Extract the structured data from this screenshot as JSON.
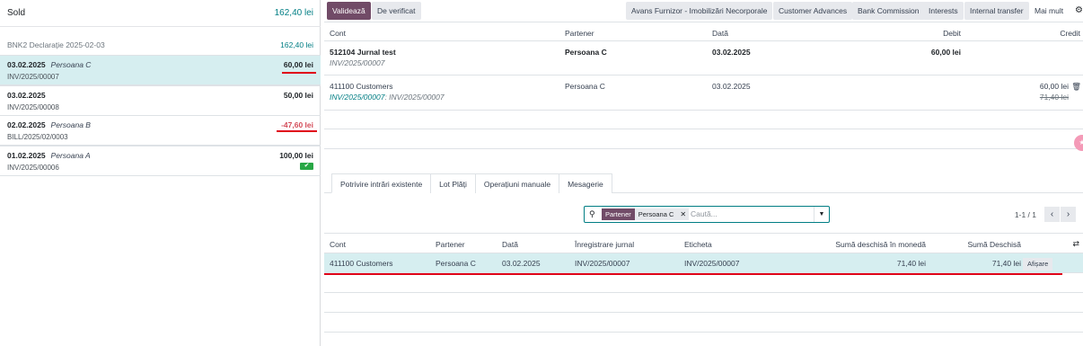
{
  "left": {
    "sold_label": "Sold",
    "sold_value": "162,40 lei",
    "statement_label": "BNK2 Declarație 2025-02-03",
    "statement_value": "162,40 lei",
    "lines": [
      {
        "date": "03.02.2025",
        "partner": "Persoana C",
        "ref": "INV/2025/00007",
        "amount": "60,00 lei",
        "selected": true
      },
      {
        "date": "03.02.2025",
        "partner": "",
        "ref": "INV/2025/00008",
        "amount": "50,00 lei"
      },
      {
        "date": "02.02.2025",
        "partner": "Persoana B",
        "ref": "BILL/2025/02/0003",
        "amount": "-47,60 lei",
        "negative": true
      },
      {
        "date": "01.02.2025",
        "partner": "Persoana A",
        "ref": "INV/2025/00006",
        "amount": "100,00 lei",
        "check": "✔"
      }
    ]
  },
  "toolbar": {
    "validate": "Validează",
    "to_check": "De verificat",
    "models": [
      "Avans Furnizor - Imobilizări Necorporale",
      "Customer Advances",
      "Bank Commission",
      "Interests",
      "Internal transfer"
    ],
    "more": "Mai mult",
    "settings_icon": "gear-icon"
  },
  "entries": {
    "headers": {
      "cont": "Cont",
      "partener": "Partener",
      "data": "Dată",
      "debit": "Debit",
      "credit": "Credit"
    },
    "row1": {
      "cont": "512104 Jurnal test",
      "sub": "INV/2025/00007",
      "partener": "Persoana C",
      "data": "03.02.2025",
      "debit": "60,00 lei",
      "credit": ""
    },
    "row2": {
      "cont": "411100 Customers",
      "sub_link": "INV/2025/00007",
      "sub_rest": ": INV/2025/00007",
      "partener": "Persoana C",
      "data": "03.02.2025",
      "credit": "60,00 lei",
      "credit_old": "71,40 lei"
    }
  },
  "tabs": [
    "Potrivire intrări existente",
    "Lot Plăți",
    "Operațiuni manuale",
    "Mesagerie"
  ],
  "search": {
    "facet_key": "Partener",
    "facet_value": "Persoana C",
    "placeholder": "Caută..."
  },
  "pager": {
    "text": "1-1 / 1",
    "prev": "‹",
    "next": "›"
  },
  "results": {
    "headers": {
      "cont": "Cont",
      "partener": "Partener",
      "data": "Dată",
      "jurnal": "Înregistrare jurnal",
      "eticheta": "Eticheta",
      "suma_moneda": "Sumă deschisă în monedă",
      "suma": "Sumă Deschisă"
    },
    "row": {
      "cont": "411100 Customers",
      "partener": "Persoana C",
      "data": "03.02.2025",
      "jurnal": "INV/2025/00007",
      "eticheta": "INV/2025/00007",
      "suma_moneda": "71,40 lei",
      "suma": "71,40 lei",
      "action": "Afișare"
    }
  },
  "colors": {
    "accent": "#714b67",
    "teal": "#017e84",
    "selected_bg": "#d6eef0",
    "annotation_red": "#e0001a"
  }
}
